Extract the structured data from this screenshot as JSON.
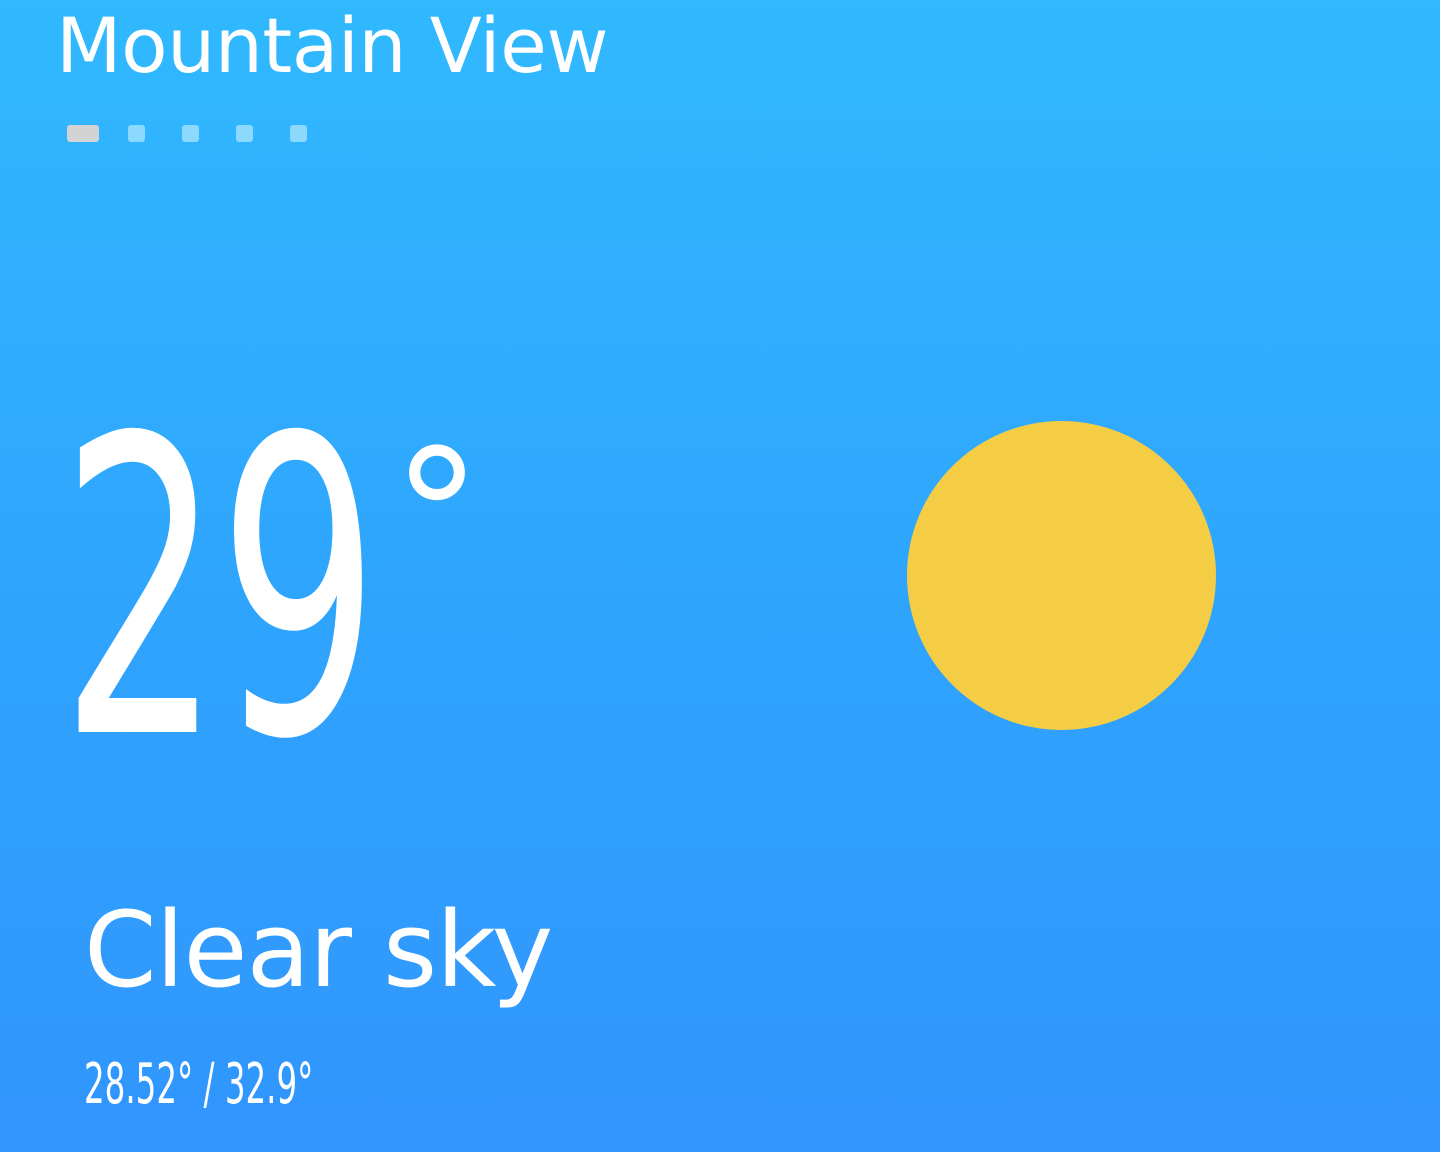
{
  "header": {
    "city": "Mountain View"
  },
  "page_indicator": {
    "count": 5,
    "active_index": 0,
    "active_color": "#D3D3D3",
    "inactive_color": "#8CD9FE"
  },
  "current": {
    "temperature": "29",
    "unit": "°",
    "condition": "Clear sky",
    "icon": "sun-icon",
    "icon_color": "#F4CD45",
    "min": "28.52°",
    "separator": "/",
    "max": "32.9°"
  },
  "colors": {
    "background_top": "#30B9FE",
    "background_bottom": "#3095FD",
    "text": "#FFFFFF"
  }
}
